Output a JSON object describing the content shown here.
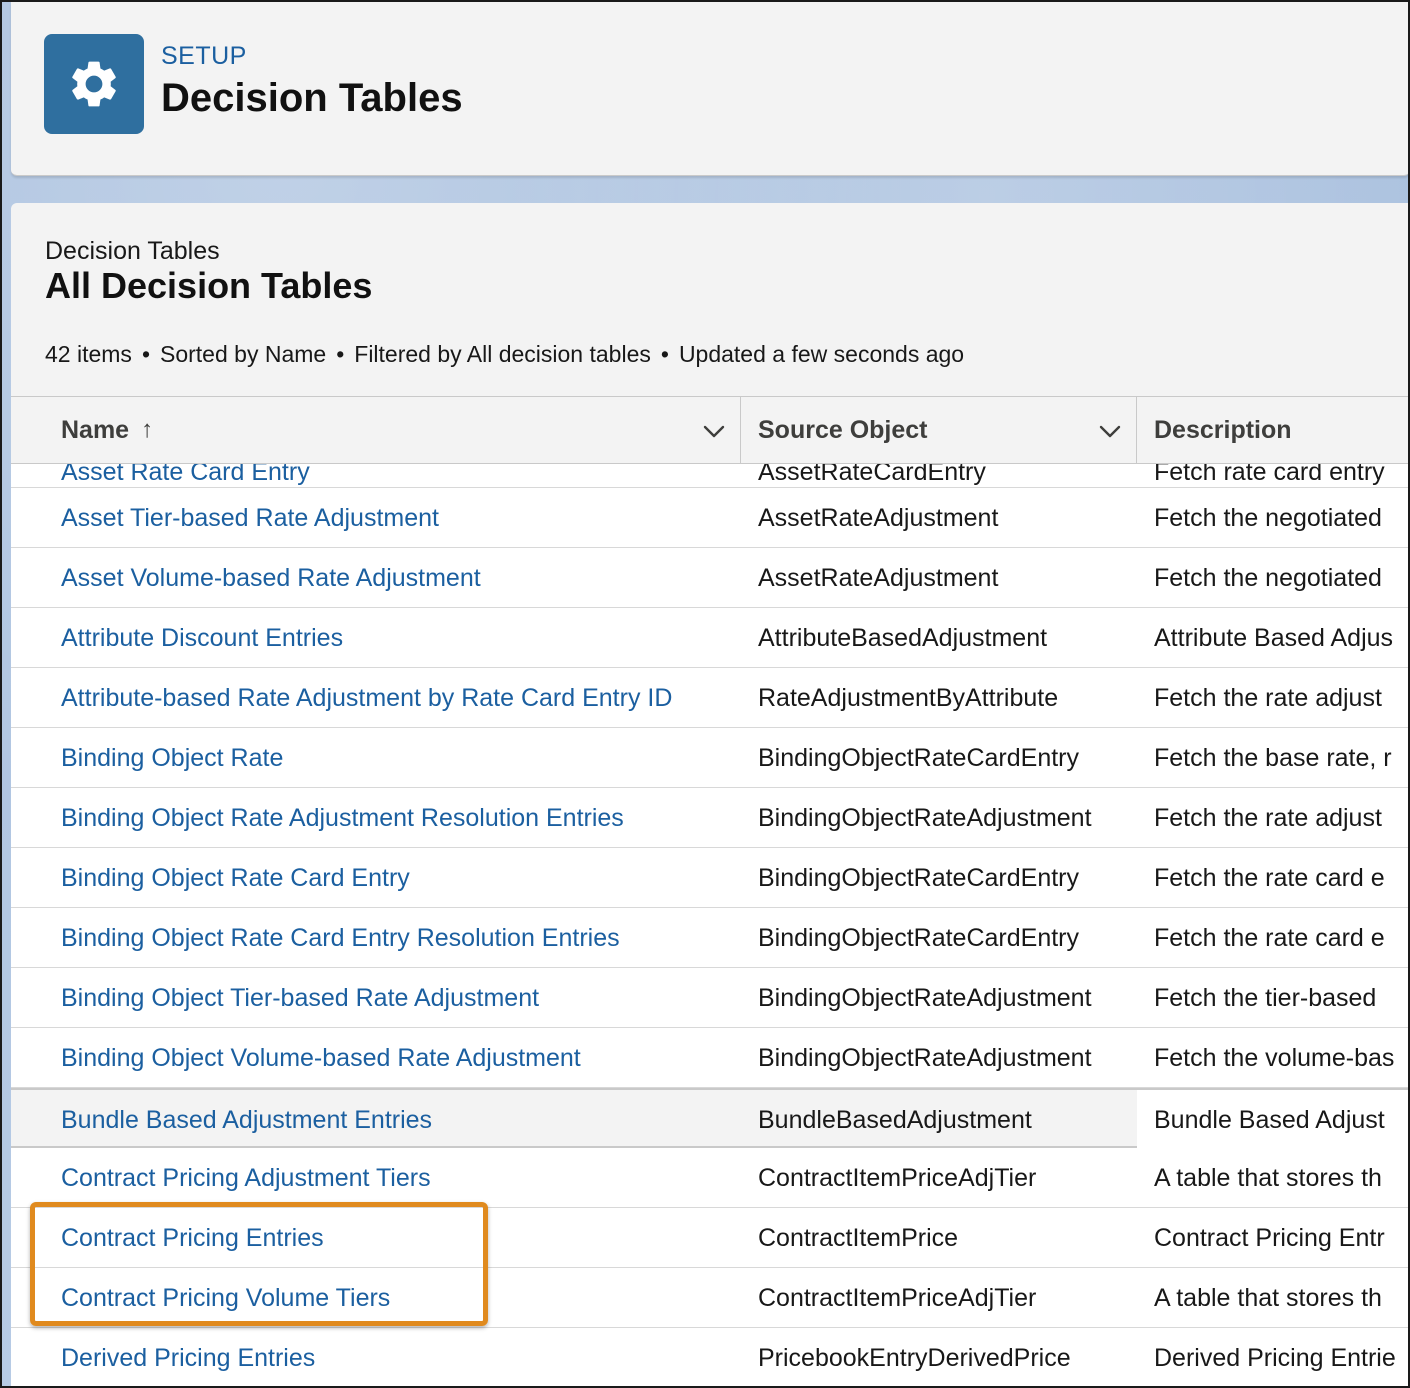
{
  "header": {
    "eyebrow": "SETUP",
    "title": "Decision Tables",
    "icon": "gear-icon"
  },
  "list": {
    "eyebrow": "Decision Tables",
    "title": "All Decision Tables",
    "meta": {
      "items": "42 items",
      "sorted": "Sorted by Name",
      "filtered": "Filtered by All decision tables",
      "updated": "Updated a few seconds ago",
      "separator": "•"
    }
  },
  "table": {
    "columns": {
      "name": "Name",
      "source": "Source Object",
      "description": "Description",
      "sort_indicator": "↑"
    },
    "partial_row": {
      "name": "Asset Rate Card Entry",
      "source": "AssetRateCardEntry",
      "description": "Fetch rate card entry"
    },
    "rows": [
      {
        "name": "Asset Tier-based Rate Adjustment",
        "source": "AssetRateAdjustment",
        "description": "Fetch the negotiated"
      },
      {
        "name": "Asset Volume-based Rate Adjustment",
        "source": "AssetRateAdjustment",
        "description": "Fetch the negotiated"
      },
      {
        "name": "Attribute Discount Entries",
        "source": "AttributeBasedAdjustment",
        "description": "Attribute Based Adjus"
      },
      {
        "name": "Attribute-based Rate Adjustment by Rate Card Entry ID",
        "source": "RateAdjustmentByAttribute",
        "description": "Fetch the rate adjust"
      },
      {
        "name": "Binding Object Rate",
        "source": "BindingObjectRateCardEntry",
        "description": "Fetch the base rate, r"
      },
      {
        "name": "Binding Object Rate Adjustment Resolution Entries",
        "source": "BindingObjectRateAdjustment",
        "description": "Fetch the rate adjust"
      },
      {
        "name": "Binding Object Rate Card Entry",
        "source": "BindingObjectRateCardEntry",
        "description": "Fetch the rate card e"
      },
      {
        "name": "Binding Object Rate Card Entry Resolution Entries",
        "source": "BindingObjectRateCardEntry",
        "description": "Fetch the rate card e"
      },
      {
        "name": "Binding Object Tier-based Rate Adjustment",
        "source": "BindingObjectRateAdjustment",
        "description": "Fetch the tier-based"
      },
      {
        "name": "Binding Object Volume-based Rate Adjustment",
        "source": "BindingObjectRateAdjustment",
        "description": "Fetch the volume-bas"
      },
      {
        "name": "Bundle Based Adjustment Entries",
        "source": "BundleBasedAdjustment",
        "description": "Bundle Based Adjust"
      },
      {
        "name": "Contract Pricing Adjustment Tiers",
        "source": "ContractItemPriceAdjTier",
        "description": "A table that stores th"
      },
      {
        "name": "Contract Pricing Entries",
        "source": "ContractItemPrice",
        "description": "Contract Pricing Entr"
      },
      {
        "name": "Contract Pricing Volume Tiers",
        "source": "ContractItemPriceAdjTier",
        "description": "A table that stores th"
      },
      {
        "name": "Derived Pricing Entries",
        "source": "PricebookEntryDerivedPrice",
        "description": "Derived Pricing Entrie"
      }
    ]
  },
  "colors": {
    "link": "#1b5fa0",
    "icon_bg": "#2f6f9f",
    "highlight": "#e08a1e"
  }
}
